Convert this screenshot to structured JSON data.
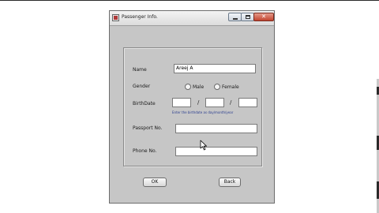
{
  "window": {
    "title": "Passenger Info."
  },
  "form": {
    "name_label": "Name",
    "name_value": "Areej A",
    "gender_label": "Gender",
    "gender_options": [
      "Male",
      "Female"
    ],
    "birthdate_label": "BirthDate",
    "birthdate_separator": "/",
    "birthdate_hint": "Enter the birthdate as day/month/year",
    "passport_label": "Passport No.",
    "phone_label": "Phone No."
  },
  "buttons": {
    "ok": "OK",
    "back": "Back"
  },
  "icons": {
    "app": "app-icon",
    "minimize": "minimize-icon",
    "maximize": "maximize-icon",
    "close": "close-icon",
    "cursor": "mouse-cursor-icon"
  }
}
